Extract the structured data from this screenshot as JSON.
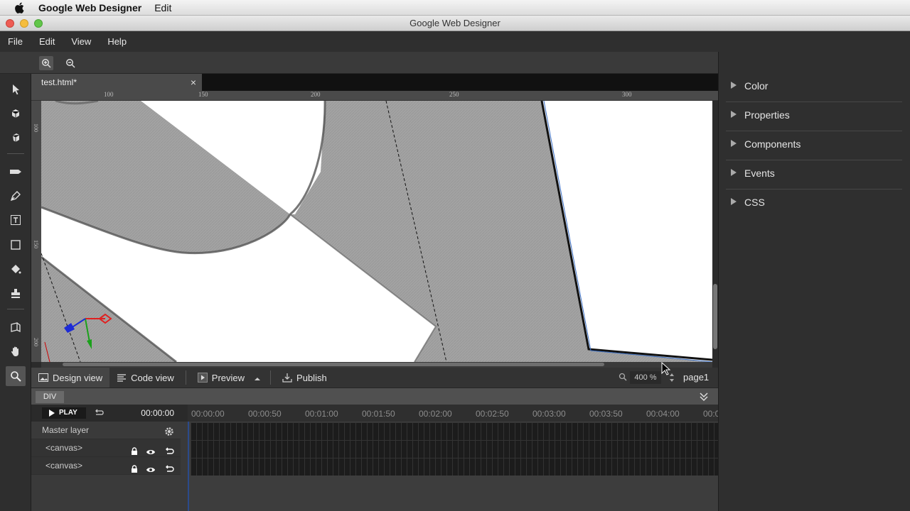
{
  "mac_menubar": {
    "app_name": "Google Web Designer",
    "menu_edit": "Edit"
  },
  "window": {
    "title": "Google Web Designer"
  },
  "menubar": {
    "items": [
      "File",
      "Edit",
      "View",
      "Help"
    ]
  },
  "document_tab": {
    "name": "test.html*",
    "close": "×"
  },
  "ruler": {
    "ticks": [
      "100",
      "150",
      "200",
      "250",
      "300"
    ]
  },
  "vruler": {
    "labels": [
      "100",
      "150",
      "200"
    ]
  },
  "viewbar": {
    "design_view": "Design view",
    "code_view": "Code view",
    "preview": "Preview",
    "publish": "Publish",
    "zoom": "400 %",
    "page": "page1"
  },
  "element_tag": "DIV",
  "timeline": {
    "play_label": "PLAY",
    "timecode": "00:00:00",
    "master_layer": "Master layer",
    "layers": [
      "<canvas>",
      "<canvas>"
    ],
    "ticks": [
      "00:00:00",
      "00:00:50",
      "00:01:00",
      "00:01:50",
      "00:02:00",
      "00:02:50",
      "00:03:00",
      "00:03:50",
      "00:04:00",
      "00:0"
    ]
  },
  "right_panel": {
    "sections": [
      "Color",
      "Properties",
      "Components",
      "Events",
      "CSS"
    ]
  },
  "colors": {
    "accent": "#3b6fc4",
    "axis_x": "#e02020",
    "axis_y": "#1aa11a",
    "axis_z": "#1d2bd6"
  },
  "icons": [
    "apple-icon",
    "zoom-in-icon",
    "zoom-out-icon",
    "expand-panel-icon",
    "selection-tool-icon",
    "3d-rotation-tool-icon",
    "3d-translation-tool-icon",
    "tag-tool-icon",
    "pen-tool-icon",
    "text-tool-icon",
    "shape-tool-icon",
    "fill-tool-icon",
    "stamp-tool-icon",
    "3d-object-tool-icon",
    "hand-tool-icon",
    "zoom-tool-icon",
    "lock-icon",
    "eye-icon",
    "undo-icon",
    "gear-icon"
  ]
}
